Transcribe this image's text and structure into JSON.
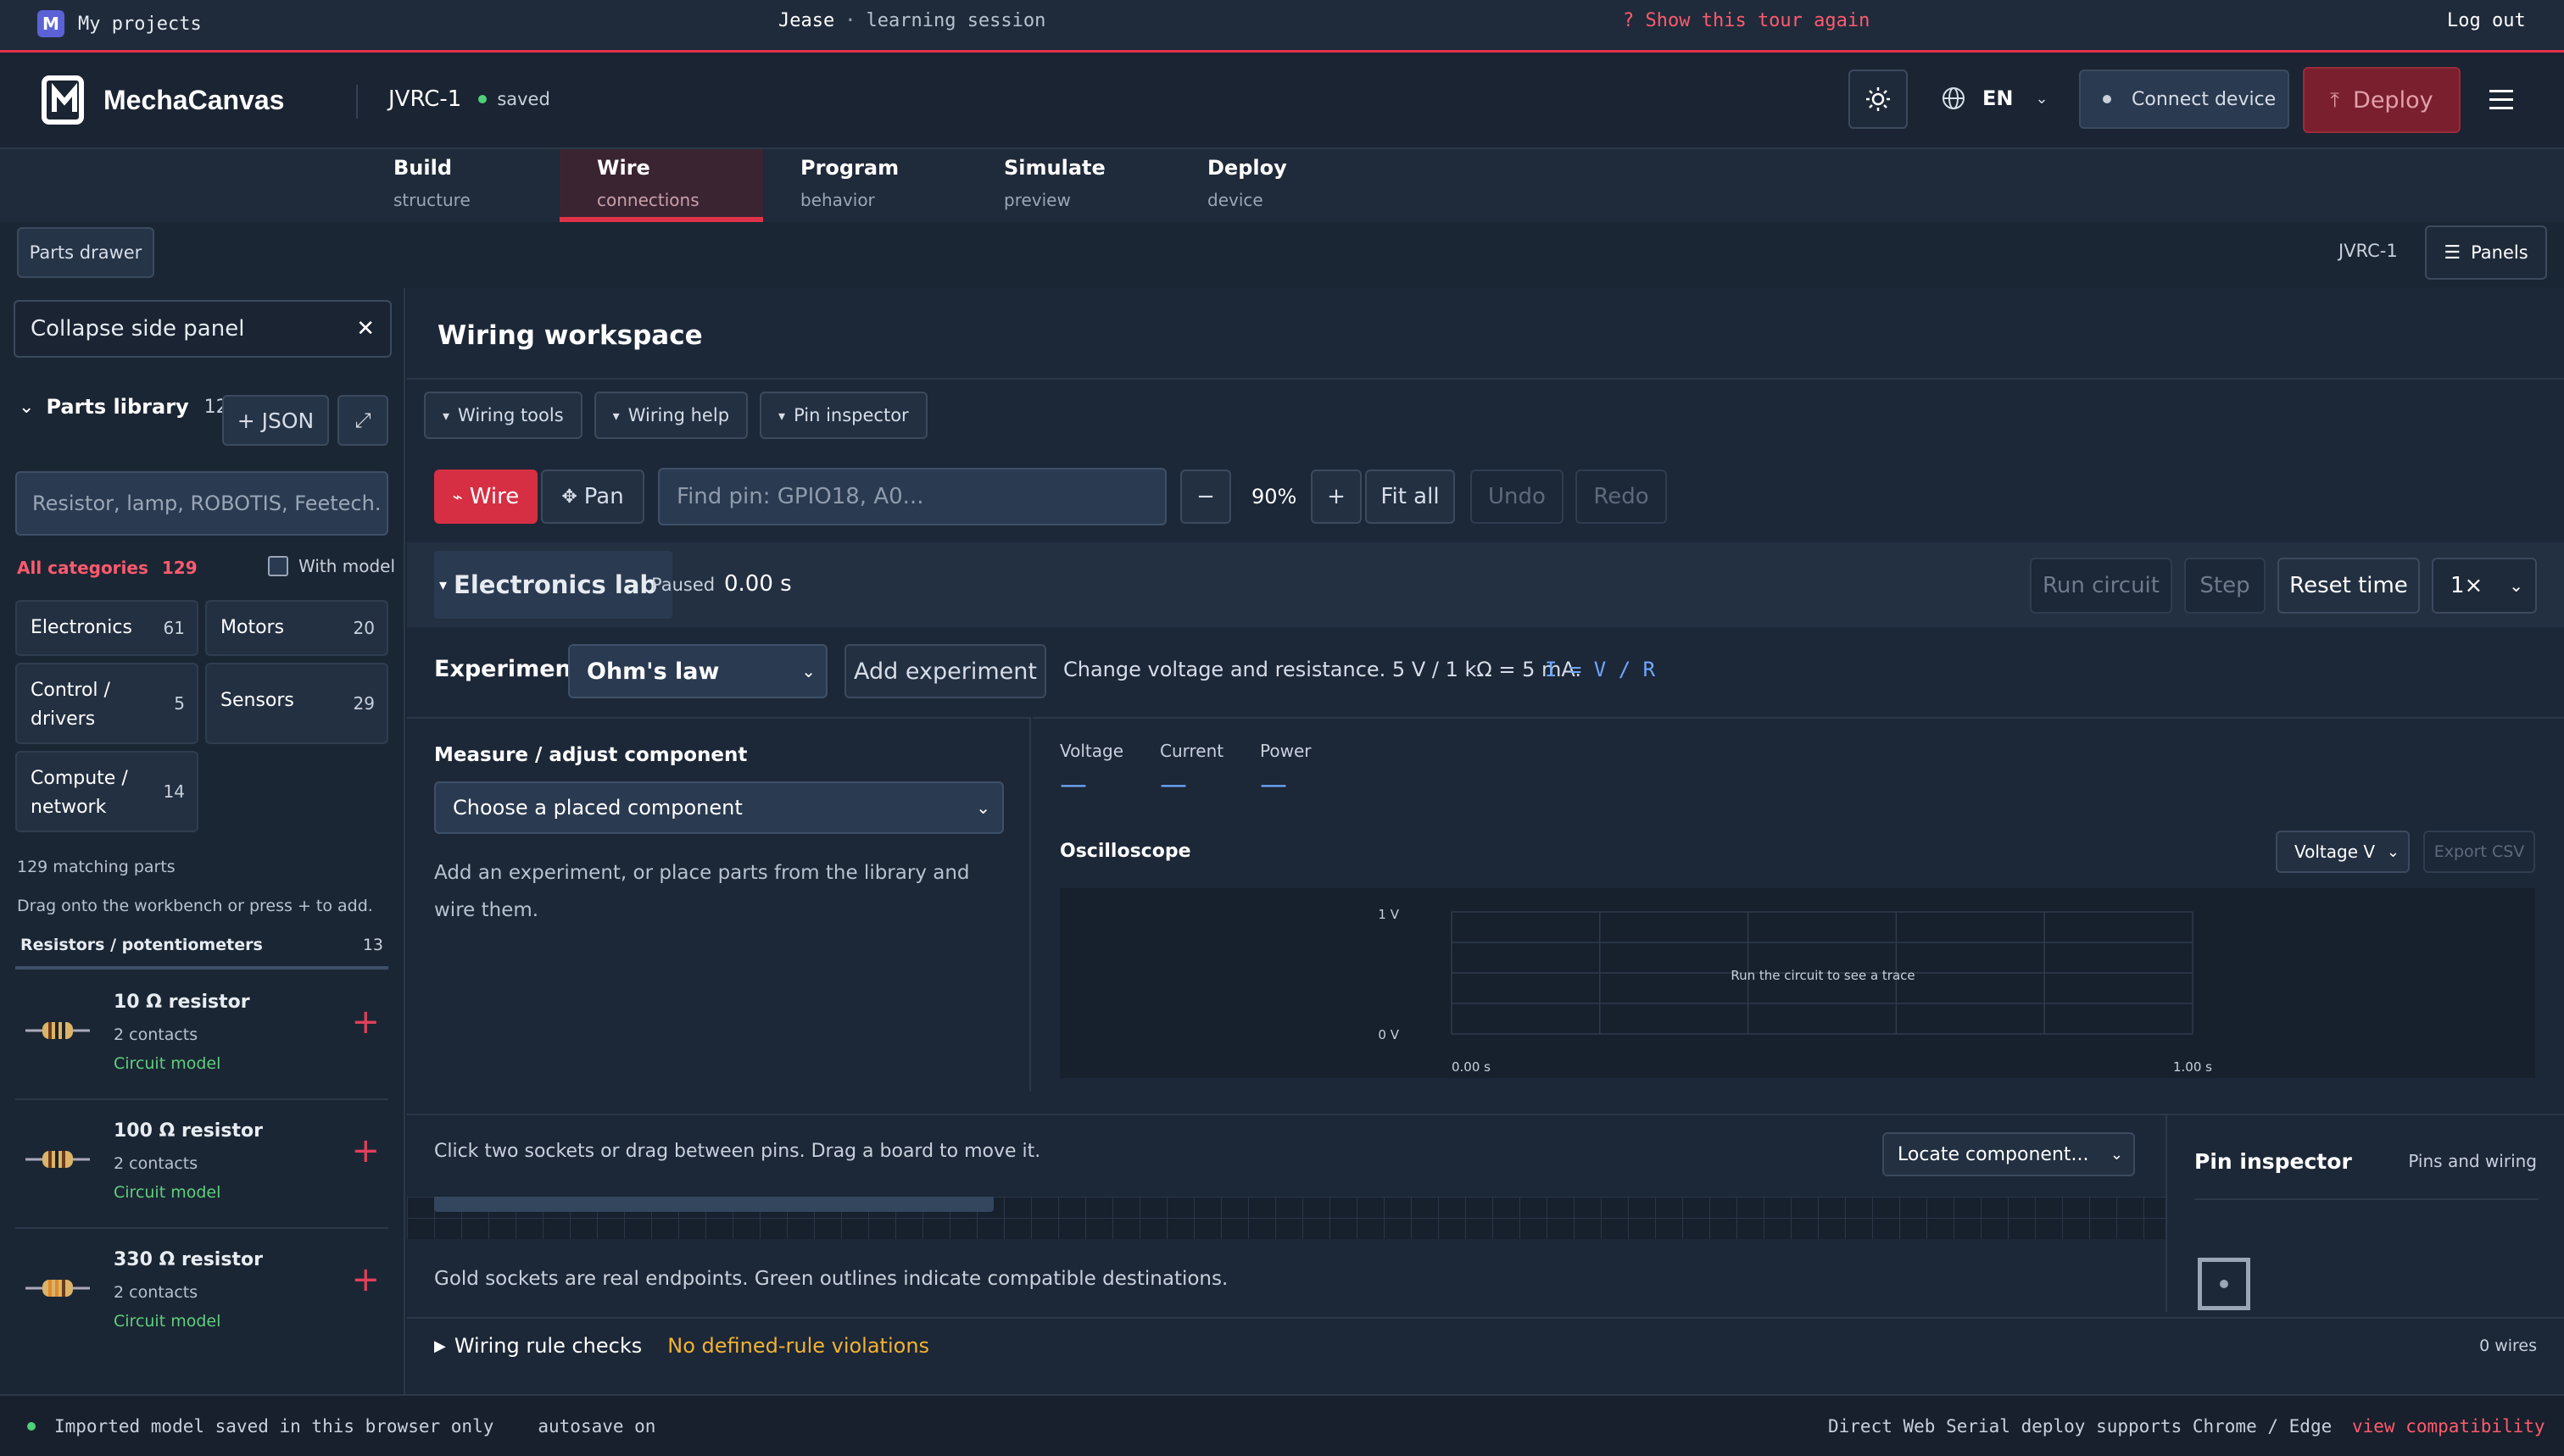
{
  "topbar": {
    "my_projects": "My projects",
    "user": "Jease",
    "sep": "·",
    "session": "learning session",
    "tour": "? Show this tour again",
    "logout": "Log out"
  },
  "header": {
    "brand": "MechaCanvas",
    "project": "JVRC-1",
    "saved": "saved",
    "lang": "EN",
    "connect": "Connect device",
    "deploy": "Deploy"
  },
  "tabs": [
    {
      "label": "Build",
      "sub": "structure"
    },
    {
      "label": "Wire",
      "sub": "connections"
    },
    {
      "label": "Program",
      "sub": "behavior"
    },
    {
      "label": "Simulate",
      "sub": "preview"
    },
    {
      "label": "Deploy",
      "sub": "device"
    }
  ],
  "subbar": {
    "parts_drawer": "Parts drawer",
    "robot": "JVRC-1",
    "panels": "Panels"
  },
  "sidebar": {
    "collapse": "Collapse side panel",
    "library_title": "Parts library",
    "library_count": "129",
    "json_btn": "+ JSON",
    "search_placeholder": "Resistor, lamp, ROBOTIS, Feetech.",
    "all_categories": "All categories",
    "all_count": "129",
    "with_model": "With model",
    "categories": [
      {
        "name": "Electronics",
        "count": "61"
      },
      {
        "name": "Motors",
        "count": "20"
      },
      {
        "name": "Control / drivers",
        "count": "5"
      },
      {
        "name": "Sensors",
        "count": "29"
      },
      {
        "name": "Compute / network",
        "count": "14"
      }
    ],
    "matching": "129 matching parts",
    "hint": "Drag onto the workbench or press + to add.",
    "group_title": "Resistors / potentiometers",
    "group_count": "13",
    "parts": [
      {
        "name": "10 Ω resistor",
        "contacts": "2 contacts",
        "model": "Circuit model"
      },
      {
        "name": "100 Ω resistor",
        "contacts": "2 contacts",
        "model": "Circuit model"
      },
      {
        "name": "330 Ω resistor",
        "contacts": "2 contacts",
        "model": "Circuit model"
      }
    ]
  },
  "workspace": {
    "title": "Wiring workspace",
    "tool_tabs": [
      "Wiring tools",
      "Wiring help",
      "Pin inspector"
    ],
    "wire": "Wire",
    "pan": "Pan",
    "find_placeholder": "Find pin: GPIO18, A0...",
    "minus": "−",
    "zoom": "90%",
    "plus": "+",
    "fit": "Fit all",
    "undo": "Undo",
    "redo": "Redo"
  },
  "lab": {
    "title": "Electronics lab",
    "paused": "Paused",
    "time": "0.00 s",
    "run": "Run circuit",
    "step": "Step",
    "reset": "Reset time",
    "speed": "1×",
    "experiments_label": "Experiments",
    "experiment": "Ohm's law",
    "add_experiment": "Add experiment",
    "description": "Change voltage and resistance. 5 V / 1 kΩ = 5 mA.",
    "formula": "I = V / R",
    "measure_title": "Measure / adjust component",
    "measure_select": "Choose a placed component",
    "measure_hint": "Add an experiment, or place parts from the library and wire them.",
    "readouts": [
      {
        "label": "Voltage",
        "value": "—"
      },
      {
        "label": "Current",
        "value": "—"
      },
      {
        "label": "Power",
        "value": "—"
      }
    ],
    "scope_title": "Oscilloscope",
    "scope_select": "Voltage V",
    "export": "Export CSV"
  },
  "chart_data": {
    "type": "line",
    "series": [],
    "y_ticks": [
      "1 V",
      "0 V"
    ],
    "x_ticks": [
      "0.00 s",
      "1.00 s"
    ],
    "annotation": "Run the circuit to see a trace",
    "ylim": [
      0,
      1
    ],
    "xlim": [
      0,
      1
    ],
    "grid": true
  },
  "canvas": {
    "hint": "Click two sockets or drag between pins. Drag a board to move it.",
    "locate": "Locate component...",
    "legend": "Gold sockets are real endpoints. Green outlines indicate compatible destinations.",
    "rules": "Wiring rule checks",
    "no_violations": "No defined-rule violations",
    "wires": "0 wires"
  },
  "pin_inspector": {
    "title": "Pin inspector",
    "sub": "Pins and wiring"
  },
  "footer": {
    "imported": "Imported model saved in this browser only",
    "autosave": "autosave on",
    "serial": "Direct Web Serial deploy supports Chrome / Edge",
    "compat": "view compatibility"
  },
  "colors": {
    "accent": "#e0334a",
    "green": "#5fcf7c",
    "gold": "#f2b233",
    "formula": "#6fa8ff"
  }
}
